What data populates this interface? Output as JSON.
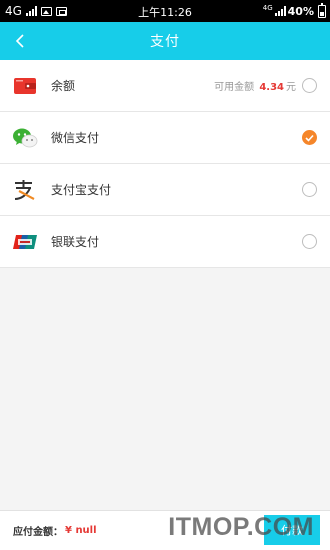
{
  "status_bar": {
    "network": "4G",
    "time": "上午11:26",
    "network_right": "4G",
    "battery": "40%"
  },
  "header": {
    "title": "支付"
  },
  "payment_methods": [
    {
      "label": "余额",
      "extra_label": "可用金额",
      "extra_amount": "4.34",
      "extra_unit": "元",
      "selected": false,
      "icon": "wallet-icon"
    },
    {
      "label": "微信支付",
      "selected": true,
      "icon": "wechat-icon"
    },
    {
      "label": "支付宝支付",
      "selected": false,
      "icon": "alipay-icon"
    },
    {
      "label": "银联支付",
      "selected": false,
      "icon": "unionpay-icon"
    }
  ],
  "bottom_bar": {
    "due_label": "应付金额：",
    "due_value": "¥ null",
    "pay_button_label": "付款"
  },
  "watermark": "ITMOP.COM",
  "colors": {
    "header": "#17cde9",
    "selected": "#f5862a",
    "amount": "#e53935"
  }
}
